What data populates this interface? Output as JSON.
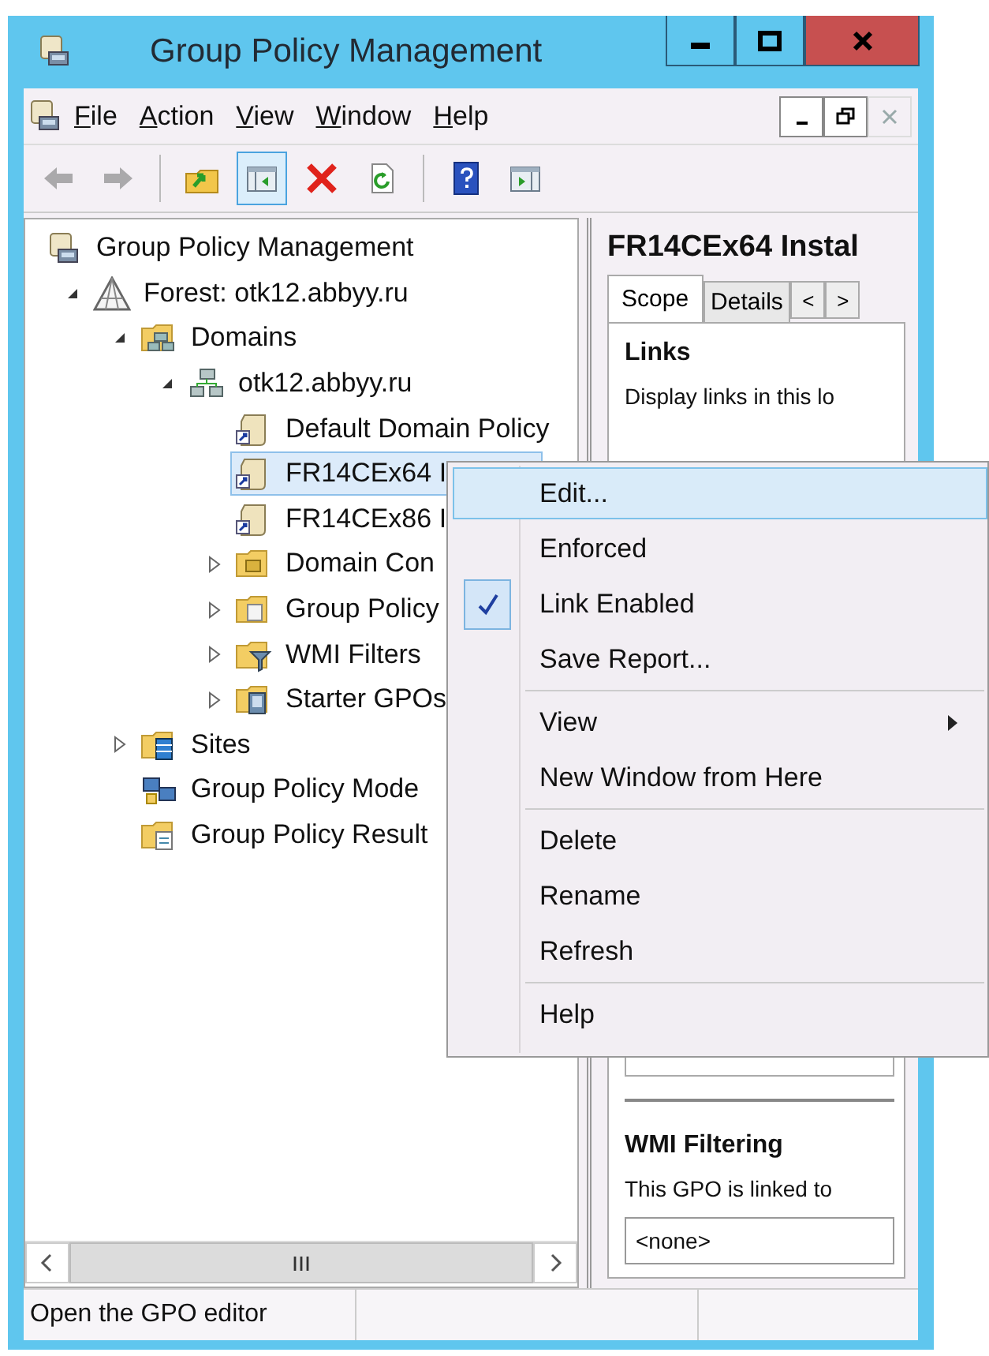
{
  "window": {
    "title": "Group Policy Management"
  },
  "menu_bar": [
    {
      "label": "File"
    },
    {
      "label": "Action"
    },
    {
      "label": "View"
    },
    {
      "label": "Window"
    },
    {
      "label": "Help"
    }
  ],
  "toolbar": [
    {
      "kind": "back",
      "disabled": true,
      "pressed": false
    },
    {
      "kind": "forward",
      "disabled": true,
      "pressed": false
    },
    {
      "kind": "separator"
    },
    {
      "kind": "up",
      "disabled": false,
      "pressed": false
    },
    {
      "kind": "console-tree",
      "disabled": false,
      "pressed": true
    },
    {
      "kind": "delete",
      "disabled": false,
      "pressed": false
    },
    {
      "kind": "refresh",
      "disabled": false,
      "pressed": false
    },
    {
      "kind": "separator"
    },
    {
      "kind": "help",
      "disabled": false,
      "pressed": false
    },
    {
      "kind": "action-pane",
      "disabled": false,
      "pressed": false
    }
  ],
  "tree": [
    {
      "label": "Group Policy Management",
      "kind": "console",
      "selected": false,
      "children": [
        {
          "label": "Forest: otk12.abbyy.ru",
          "kind": "forest",
          "expanded": true,
          "selected": false,
          "children": [
            {
              "label": "Domains",
              "kind": "domains",
              "expanded": true,
              "selected": false,
              "children": [
                {
                  "label": "otk12.abbyy.ru",
                  "kind": "domain",
                  "expanded": true,
                  "selected": false,
                  "children": [
                    {
                      "label": "Default Domain Policy",
                      "kind": "gpo-link",
                      "selected": false
                    },
                    {
                      "label": "FR14CEx64 I",
                      "kind": "gpo-link",
                      "selected": true
                    },
                    {
                      "label": "FR14CEx86 I",
                      "kind": "gpo-link",
                      "selected": false
                    },
                    {
                      "label": "Domain Con",
                      "kind": "folder",
                      "expanded": false,
                      "selected": false
                    },
                    {
                      "label": "Group Policy",
                      "kind": "folder-gpo",
                      "expanded": false,
                      "selected": false
                    },
                    {
                      "label": "WMI Filters",
                      "kind": "folder-filter",
                      "expanded": false,
                      "selected": false
                    },
                    {
                      "label": "Starter GPOs",
                      "kind": "folder-starter",
                      "expanded": false,
                      "selected": false
                    }
                  ]
                }
              ]
            },
            {
              "label": "Sites",
              "kind": "sites",
              "expanded": false,
              "selected": false
            },
            {
              "label": "Group Policy Mode",
              "kind": "modeling",
              "selected": false
            },
            {
              "label": "Group Policy Result",
              "kind": "results",
              "selected": false
            }
          ]
        }
      ]
    }
  ],
  "details": {
    "title": "FR14CEx64 Instal",
    "tabs": [
      {
        "label": "Scope",
        "selected": true
      },
      {
        "label": "Details",
        "selected": false
      }
    ],
    "tab_scroll": [
      "<",
      ">"
    ],
    "links_heading": "Links",
    "links_text": "Display links in this lo",
    "wmi_heading": "WMI Filtering",
    "wmi_text": "This GPO is linked to",
    "wmi_value": "<none>"
  },
  "context_menu": [
    {
      "kind": "item",
      "label": "Edit...",
      "selected": true,
      "checked": false,
      "submenu": false
    },
    {
      "kind": "item",
      "label": "Enforced",
      "selected": false,
      "checked": false,
      "submenu": false
    },
    {
      "kind": "item",
      "label": "Link Enabled",
      "selected": false,
      "checked": true,
      "submenu": false
    },
    {
      "kind": "item",
      "label": "Save Report...",
      "selected": false,
      "checked": false,
      "submenu": false
    },
    {
      "kind": "separator"
    },
    {
      "kind": "item",
      "label": "View",
      "selected": false,
      "checked": false,
      "submenu": true
    },
    {
      "kind": "item",
      "label": "New Window from Here",
      "selected": false,
      "checked": false,
      "submenu": false
    },
    {
      "kind": "separator"
    },
    {
      "kind": "item",
      "label": "Delete",
      "selected": false,
      "checked": false,
      "submenu": false
    },
    {
      "kind": "item",
      "label": "Rename",
      "selected": false,
      "checked": false,
      "submenu": false
    },
    {
      "kind": "item",
      "label": "Refresh",
      "selected": false,
      "checked": false,
      "submenu": false
    },
    {
      "kind": "separator"
    },
    {
      "kind": "item",
      "label": "Help",
      "selected": false,
      "checked": false,
      "submenu": false
    }
  ],
  "status_bar": {
    "text": "Open the GPO editor"
  }
}
